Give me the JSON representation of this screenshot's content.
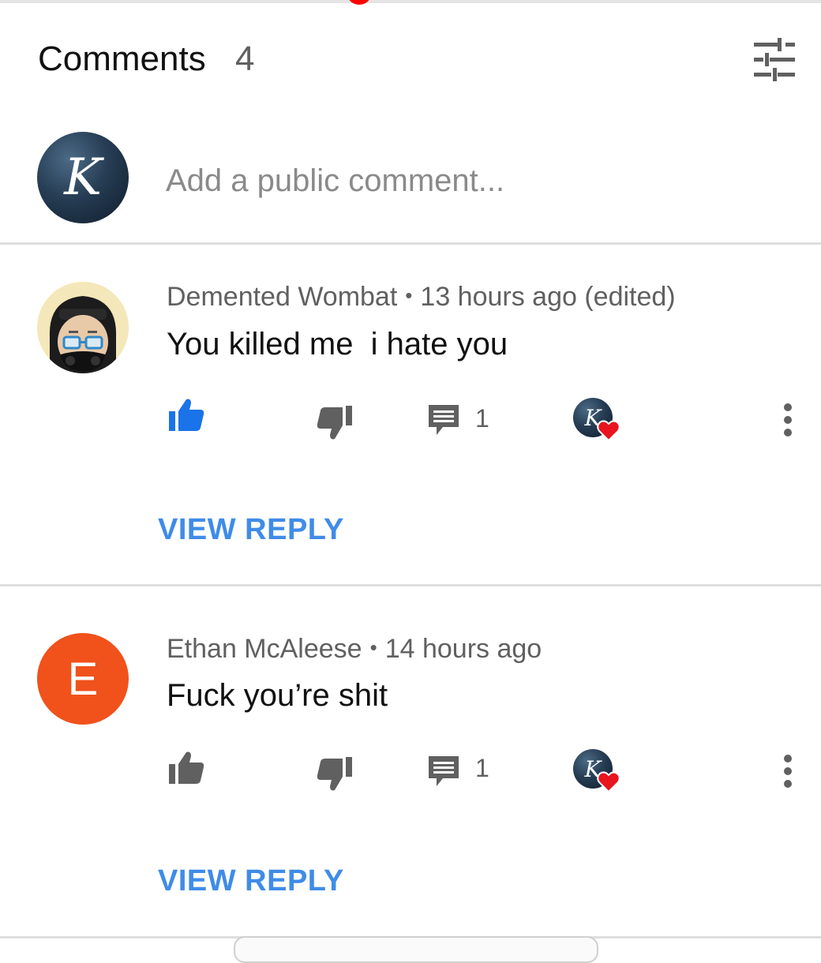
{
  "header": {
    "title": "Comments",
    "count": "4",
    "sort_icon": "sort-filter-icon"
  },
  "composer": {
    "avatar_letter": "K",
    "placeholder": "Add a public comment..."
  },
  "comments": [
    {
      "author": "Demented Wombat",
      "separator": "•",
      "time": "13 hours ago (edited)",
      "text": "You killed me  i hate you",
      "liked": true,
      "reply_count": "1",
      "hearted_by_letter": "K",
      "view_reply_label": "VIEW REPLY"
    },
    {
      "author": "Ethan McAleese",
      "avatar_letter": "E",
      "separator": "•",
      "time": "14 hours ago",
      "text": "Fuck you’re shit",
      "liked": false,
      "reply_count": "1",
      "hearted_by_letter": "K",
      "view_reply_label": "VIEW REPLY"
    }
  ],
  "colors": {
    "like_active": "#1a73e8",
    "icon_gray": "#606060",
    "link_blue": "#3f8ce8",
    "heart_red": "#e8141e",
    "avatar_e": "#f1511b"
  }
}
